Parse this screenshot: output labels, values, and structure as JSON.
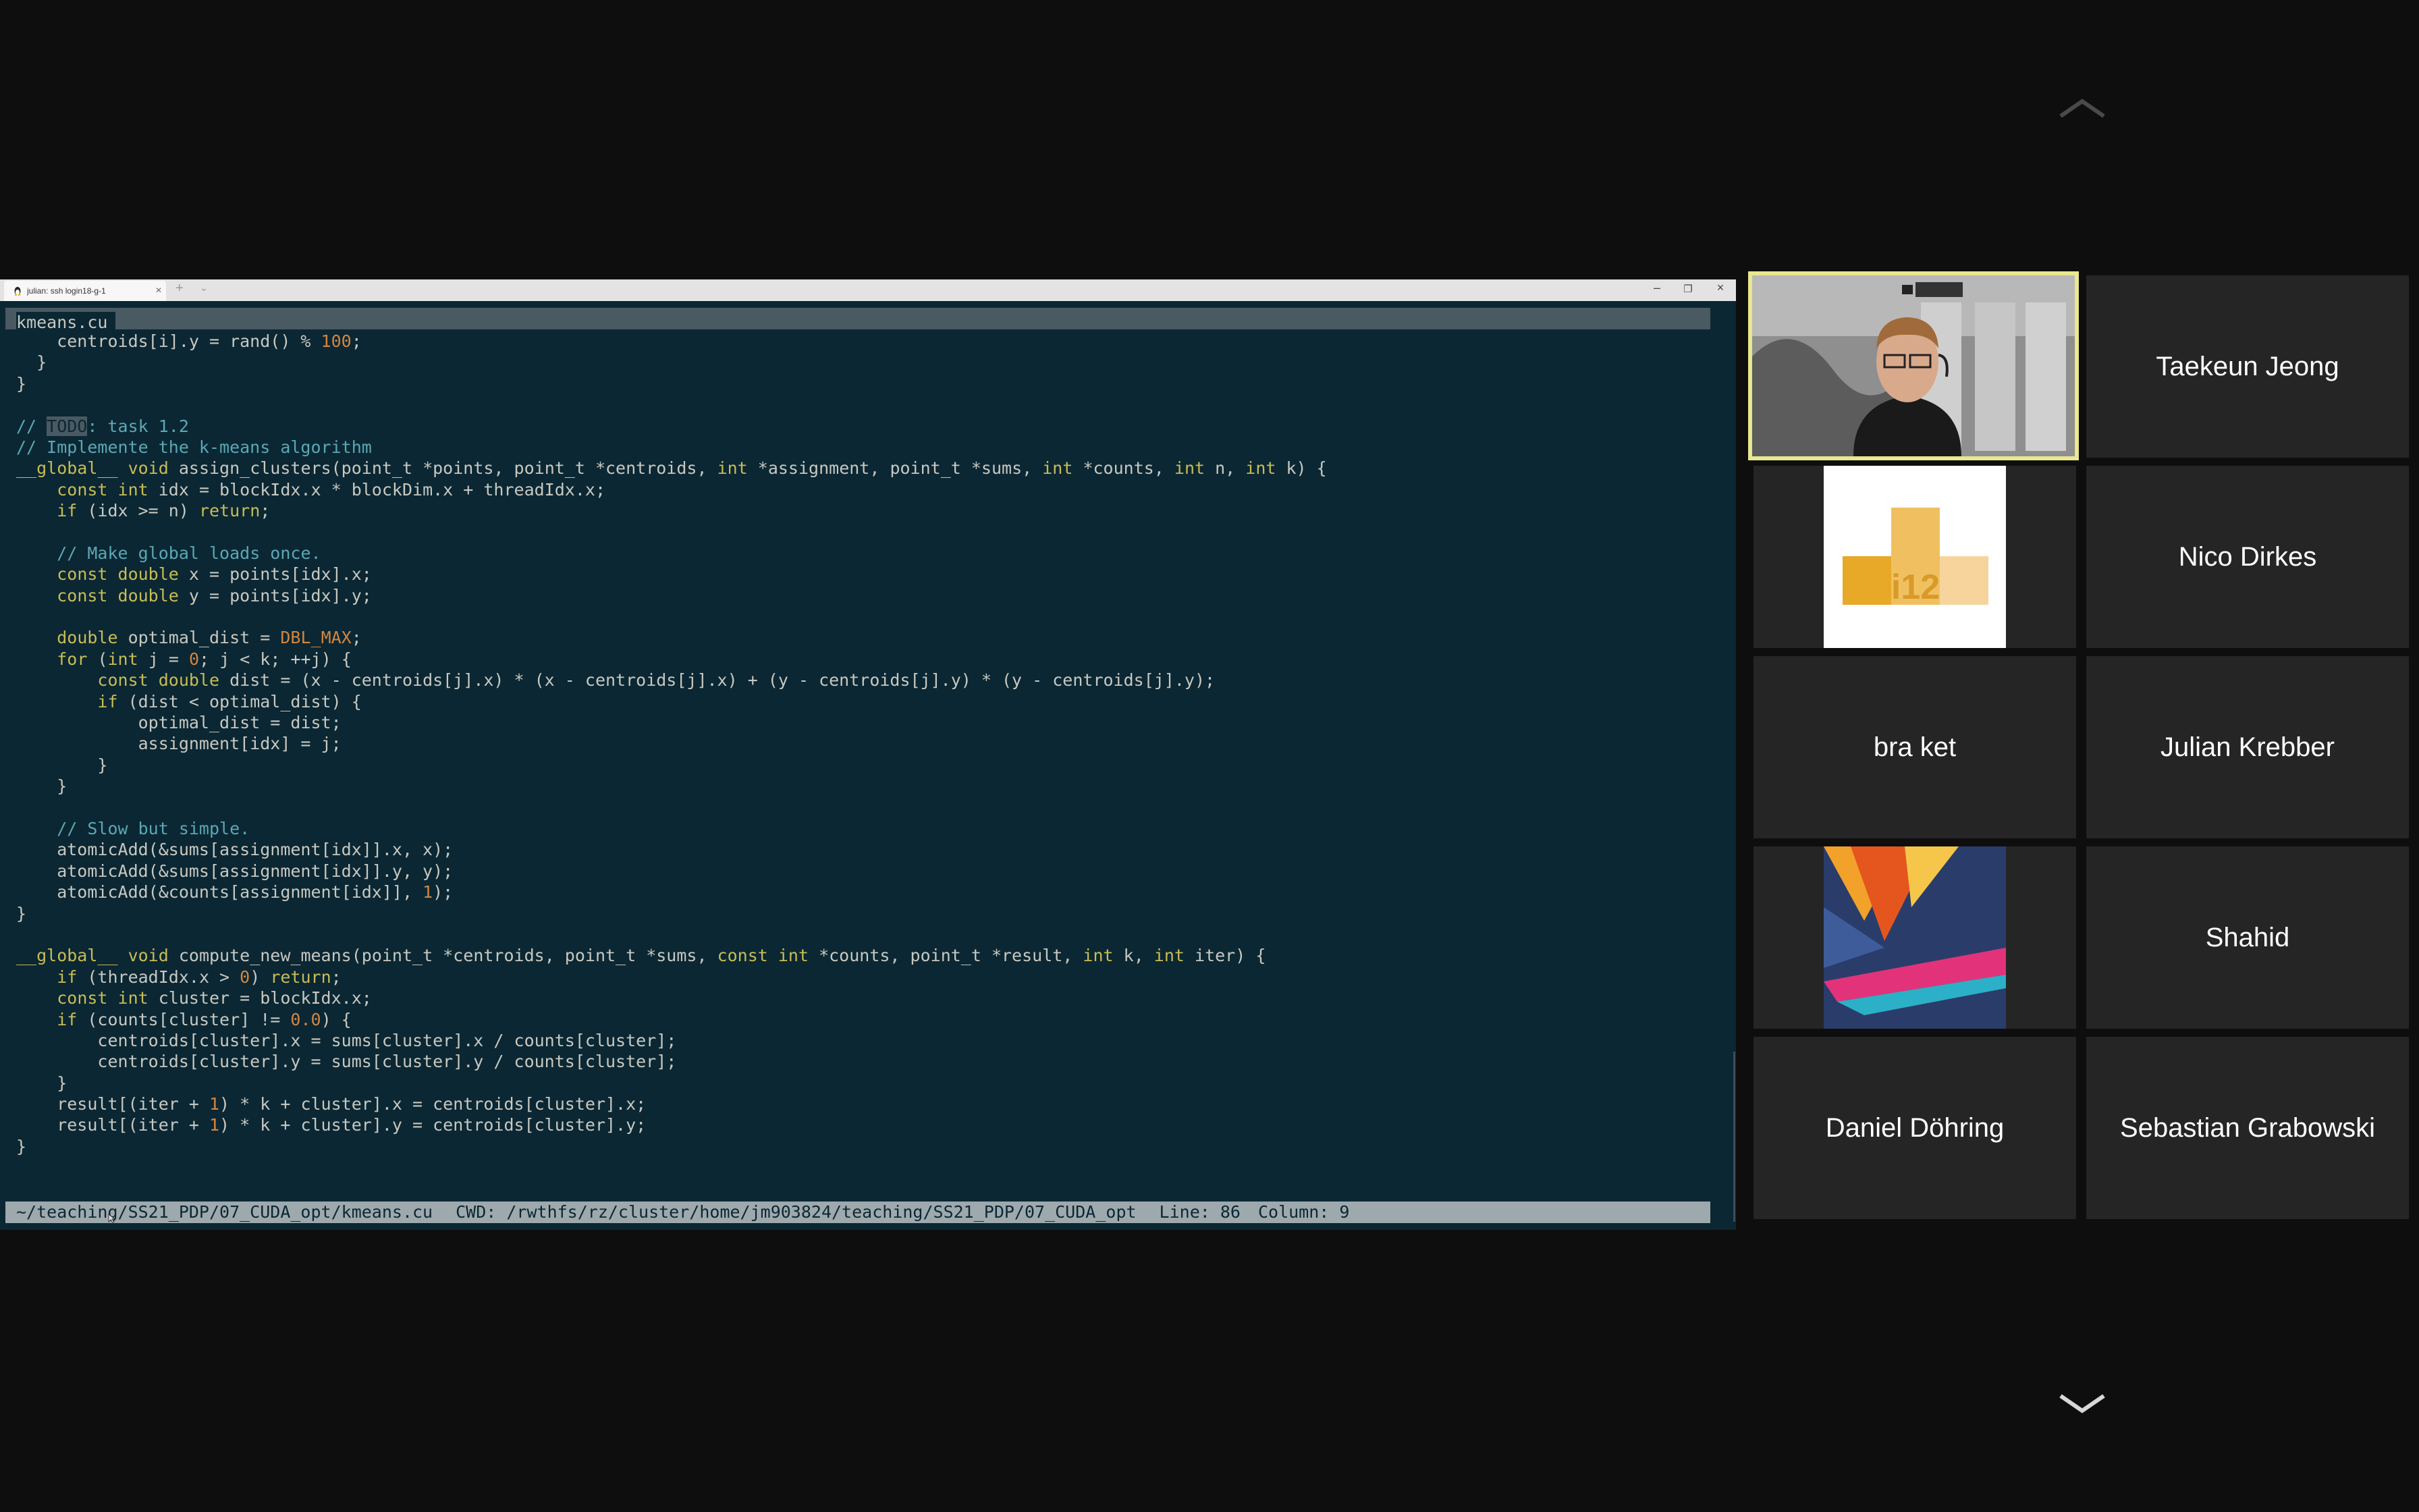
{
  "nav": {
    "up_icon": "chevron-up-icon",
    "down_icon": "chevron-down-icon"
  },
  "window": {
    "tab_title": "julian: ssh login18-g-1",
    "tab_close": "×",
    "new_tab": "+",
    "tab_dropdown": "⌄",
    "minimize": "–",
    "maximize": "❐",
    "close": "×"
  },
  "editor": {
    "filename": "kmeans.cu",
    "lines": [
      [
        {
          "t": "    centroids[i].y = rand() % "
        },
        {
          "t": "100",
          "c": "n"
        },
        {
          "t": ";"
        }
      ],
      [
        {
          "t": "  }"
        }
      ],
      [
        {
          "t": "}"
        }
      ],
      [
        {
          "t": ""
        }
      ],
      [
        {
          "t": "// ",
          "c": "cm"
        },
        {
          "t": "TODO",
          "c": "td"
        },
        {
          "t": ": task 1.2",
          "c": "cm"
        }
      ],
      [
        {
          "t": "// Implemente the k-means algorithm",
          "c": "cm"
        }
      ],
      [
        {
          "t": "__global__ ",
          "c": "k"
        },
        {
          "t": "void ",
          "c": "k"
        },
        {
          "t": "assign_clusters(point_t *points, point_t *centroids, "
        },
        {
          "t": "int ",
          "c": "k"
        },
        {
          "t": "*assignment, point_t *sums, "
        },
        {
          "t": "int ",
          "c": "k"
        },
        {
          "t": "*counts, "
        },
        {
          "t": "int ",
          "c": "k"
        },
        {
          "t": "n, "
        },
        {
          "t": "int ",
          "c": "k"
        },
        {
          "t": "k) {"
        }
      ],
      [
        {
          "t": "    "
        },
        {
          "t": "const int ",
          "c": "k"
        },
        {
          "t": "idx = blockIdx.x * blockDim.x + threadIdx.x;"
        }
      ],
      [
        {
          "t": "    "
        },
        {
          "t": "if ",
          "c": "k"
        },
        {
          "t": "(idx >= n) "
        },
        {
          "t": "return",
          "c": "k"
        },
        {
          "t": ";"
        }
      ],
      [
        {
          "t": ""
        }
      ],
      [
        {
          "t": "    "
        },
        {
          "t": "// Make global loads once.",
          "c": "cm"
        }
      ],
      [
        {
          "t": "    "
        },
        {
          "t": "const double ",
          "c": "k"
        },
        {
          "t": "x = points[idx].x;"
        }
      ],
      [
        {
          "t": "    "
        },
        {
          "t": "const double ",
          "c": "k"
        },
        {
          "t": "y = points[idx].y;"
        }
      ],
      [
        {
          "t": ""
        }
      ],
      [
        {
          "t": "    "
        },
        {
          "t": "double ",
          "c": "k"
        },
        {
          "t": "optimal_dist = "
        },
        {
          "t": "DBL_MAX",
          "c": "n"
        },
        {
          "t": ";"
        }
      ],
      [
        {
          "t": "    "
        },
        {
          "t": "for ",
          "c": "k"
        },
        {
          "t": "("
        },
        {
          "t": "int ",
          "c": "k"
        },
        {
          "t": "j = "
        },
        {
          "t": "0",
          "c": "n"
        },
        {
          "t": "; j < k; ++j) {"
        }
      ],
      [
        {
          "t": "        "
        },
        {
          "t": "const double ",
          "c": "k"
        },
        {
          "t": "dist = (x - centroids[j].x) * (x - centroids[j].x) + (y - centroids[j].y) * (y - centroids[j].y);"
        }
      ],
      [
        {
          "t": "        "
        },
        {
          "t": "if ",
          "c": "k"
        },
        {
          "t": "(dist < optimal_dist) {"
        }
      ],
      [
        {
          "t": "            optimal_dist = dist;"
        }
      ],
      [
        {
          "t": "            assignment[idx] = j;"
        }
      ],
      [
        {
          "t": "        }"
        }
      ],
      [
        {
          "t": "    }"
        }
      ],
      [
        {
          "t": ""
        }
      ],
      [
        {
          "t": "    "
        },
        {
          "t": "// Slow but simple.",
          "c": "cm"
        }
      ],
      [
        {
          "t": "    atomicAdd(&sums[assignment[idx]].x, x);"
        }
      ],
      [
        {
          "t": "    atomicAdd(&sums[assignment[idx]].y, y);"
        }
      ],
      [
        {
          "t": "    atomicAdd(&counts[assignment[idx]], "
        },
        {
          "t": "1",
          "c": "n"
        },
        {
          "t": ");"
        }
      ],
      [
        {
          "t": "}"
        }
      ],
      [
        {
          "t": ""
        }
      ],
      [
        {
          "t": "__global__ ",
          "c": "k"
        },
        {
          "t": "void ",
          "c": "k"
        },
        {
          "t": "compute_new_means(point_t *centroids, point_t *sums, "
        },
        {
          "t": "const int ",
          "c": "k"
        },
        {
          "t": "*counts, point_t *result, "
        },
        {
          "t": "int ",
          "c": "k"
        },
        {
          "t": "k, "
        },
        {
          "t": "int ",
          "c": "k"
        },
        {
          "t": "iter) {"
        }
      ],
      [
        {
          "t": "    "
        },
        {
          "t": "if ",
          "c": "k"
        },
        {
          "t": "(threadIdx.x > "
        },
        {
          "t": "0",
          "c": "n"
        },
        {
          "t": ") "
        },
        {
          "t": "return",
          "c": "k"
        },
        {
          "t": ";"
        }
      ],
      [
        {
          "t": "    "
        },
        {
          "t": "const int ",
          "c": "k"
        },
        {
          "t": "cluster = blockIdx.x;"
        }
      ],
      [
        {
          "t": "    "
        },
        {
          "t": "if ",
          "c": "k"
        },
        {
          "t": "(counts[cluster] != "
        },
        {
          "t": "0.0",
          "c": "n"
        },
        {
          "t": ") {"
        }
      ],
      [
        {
          "t": "        centroids[cluster].x = sums[cluster].x / counts[cluster];"
        }
      ],
      [
        {
          "t": "        centroids[cluster].y = sums[cluster].y / counts[cluster];"
        }
      ],
      [
        {
          "t": "    }"
        }
      ],
      [
        {
          "t": "    result[(iter + "
        },
        {
          "t": "1",
          "c": "n"
        },
        {
          "t": ") * k + cluster].x = centroids[cluster].x;"
        }
      ],
      [
        {
          "t": "    result[(iter + "
        },
        {
          "t": "1",
          "c": "n"
        },
        {
          "t": ") * k + cluster].y = centroids[cluster].y;"
        }
      ],
      [
        {
          "t": "}"
        }
      ]
    ]
  },
  "status": {
    "path": "~/teaching/SS21_PDP/07_CUDA_opt/kmeans.cu",
    "cwd": "CWD: /rwthfs/rz/cluster/home/jm903824/teaching/SS21_PDP/07_CUDA_opt",
    "line": "Line: 86",
    "column": "Column: 9"
  },
  "participants": [
    {
      "name": "",
      "type": "video"
    },
    {
      "name": "Taekeun Jeong"
    },
    {
      "name": "",
      "type": "logo",
      "logo_text": "i12"
    },
    {
      "name": "Nico Dirkes"
    },
    {
      "name": "bra ket"
    },
    {
      "name": "Julian Krebber"
    },
    {
      "name": "",
      "type": "art"
    },
    {
      "name": "Shahid"
    },
    {
      "name": "Daniel Döhring"
    },
    {
      "name": "Sebastian Grabowski"
    }
  ],
  "colors": {
    "active_speaker": "#e9e78f",
    "terminal_bg": "#0b2733",
    "keyword": "#c8bc55",
    "comment": "#5aa8b5",
    "number": "#d28640"
  }
}
